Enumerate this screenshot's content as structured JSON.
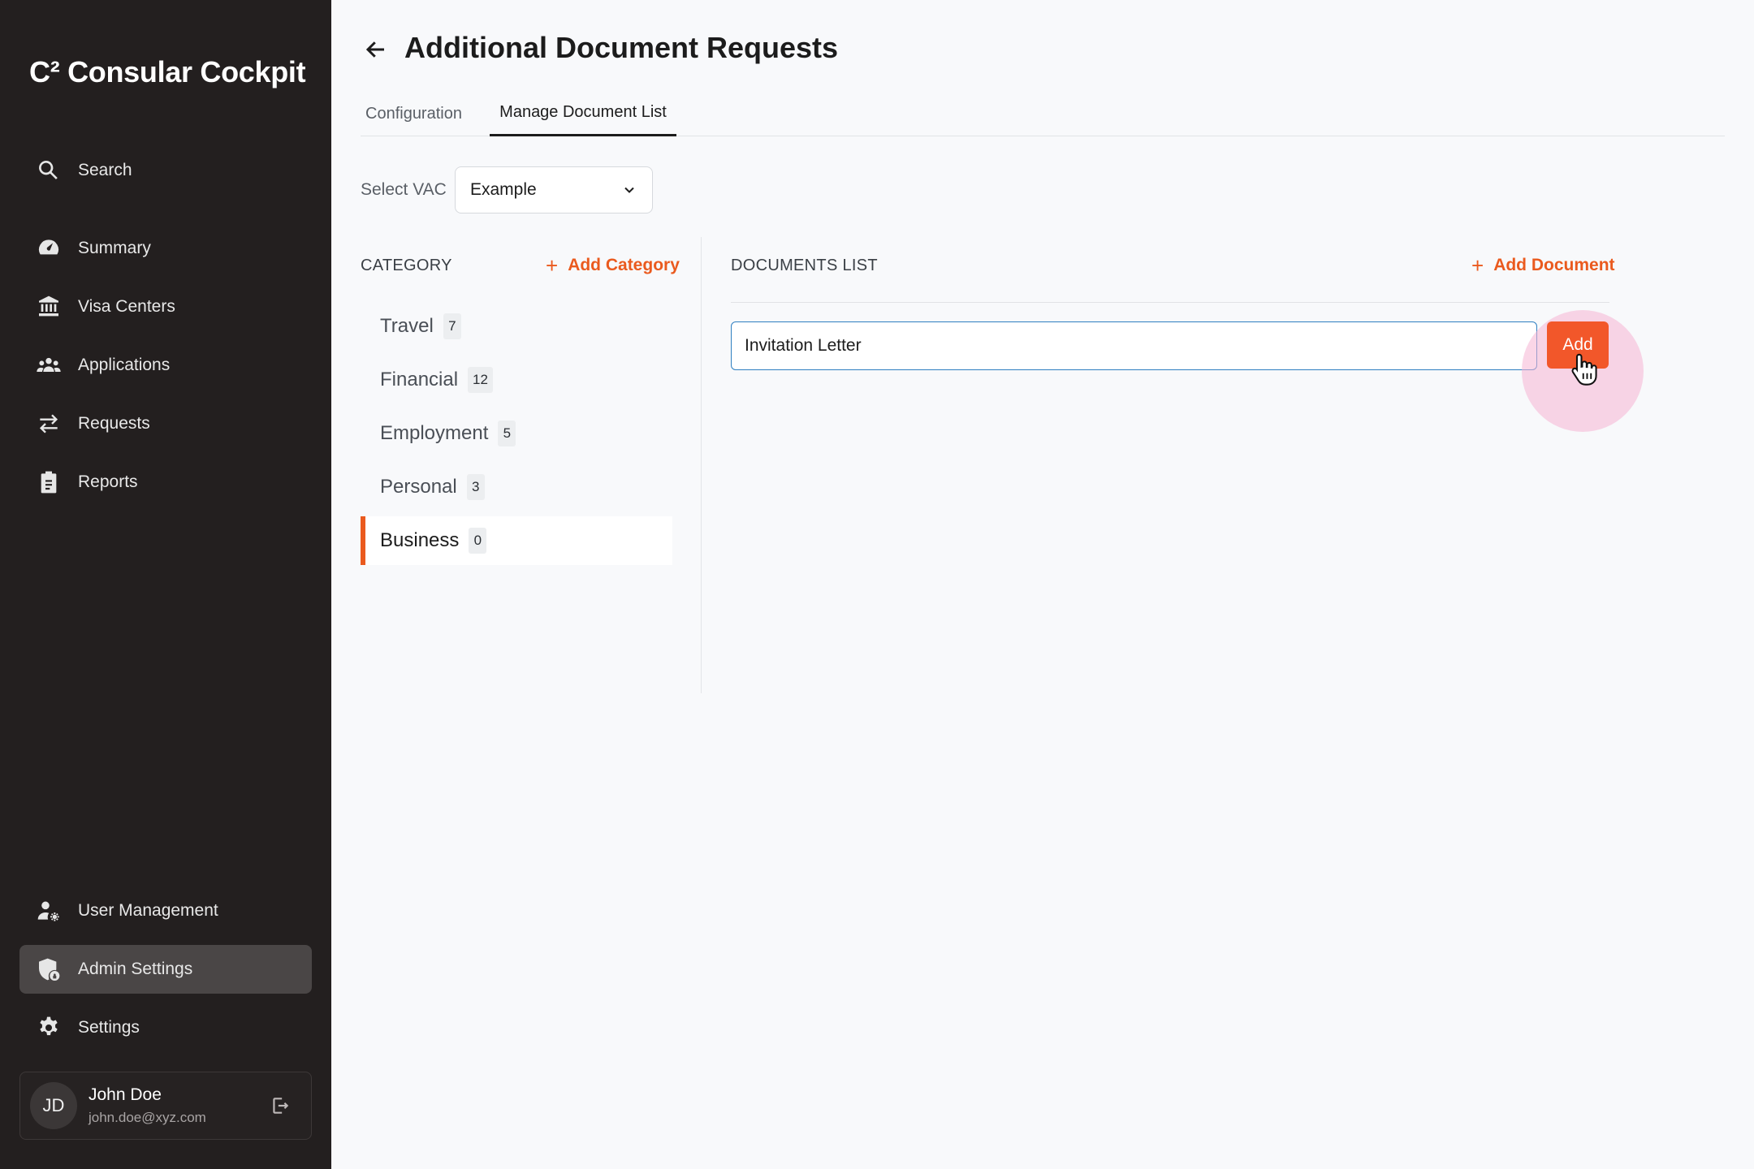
{
  "app": {
    "logo": "C² Consular Cockpit"
  },
  "sidebar": {
    "search": {
      "label": "Search",
      "icon": "search-icon"
    },
    "items": [
      {
        "label": "Summary",
        "icon": "speedometer-icon"
      },
      {
        "label": "Visa Centers",
        "icon": "bank-icon"
      },
      {
        "label": "Applications",
        "icon": "people-group-icon"
      },
      {
        "label": "Requests",
        "icon": "swap-arrows-icon"
      },
      {
        "label": "Reports",
        "icon": "clipboard-icon"
      }
    ],
    "bottom_items": [
      {
        "label": "User Management",
        "icon": "user-gear-icon"
      },
      {
        "label": "Admin Settings",
        "icon": "shield-lock-icon",
        "active": true
      },
      {
        "label": "Settings",
        "icon": "gear-icon"
      }
    ],
    "user": {
      "initials": "JD",
      "name": "John Doe",
      "email": "john.doe@xyz.com"
    }
  },
  "header": {
    "title": "Additional Document Requests"
  },
  "tabs": [
    {
      "label": "Configuration",
      "active": false
    },
    {
      "label": "Manage Document List",
      "active": true
    }
  ],
  "vac": {
    "label": "Select VAC",
    "selected": "Example"
  },
  "categories": {
    "header": "CATEGORY",
    "add_label": "Add Category",
    "items": [
      {
        "name": "Travel",
        "count": "7"
      },
      {
        "name": "Financial",
        "count": "12"
      },
      {
        "name": "Employment",
        "count": "5"
      },
      {
        "name": "Personal",
        "count": "3"
      },
      {
        "name": "Business",
        "count": "0",
        "active": true
      }
    ]
  },
  "documents": {
    "header": "DOCUMENTS LIST",
    "add_label": "Add Document",
    "input_value": "Invitation Letter",
    "add_button": "Add"
  },
  "colors": {
    "accent": "#ea5a1e",
    "button": "#f2572a",
    "sidebar_bg": "#231f1f",
    "input_border": "#2f7fc1"
  }
}
